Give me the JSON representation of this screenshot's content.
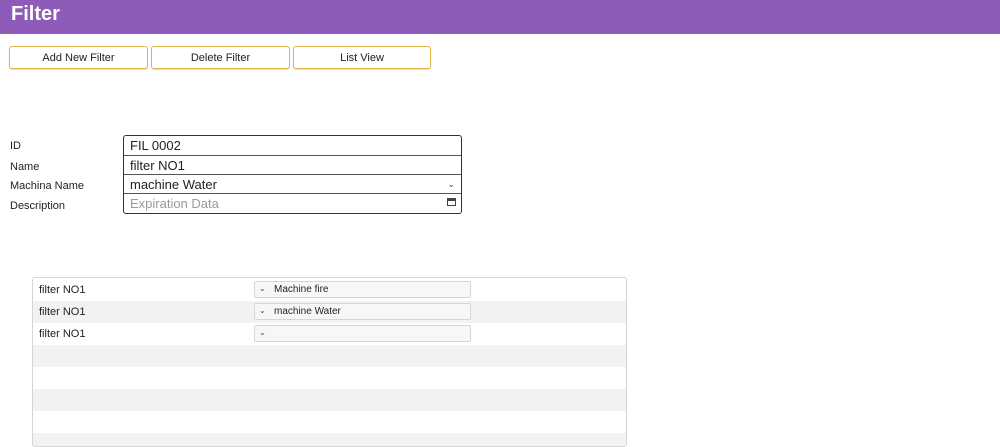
{
  "header": {
    "title": "Filter"
  },
  "toolbar": {
    "add_label": "Add New Filter",
    "delete_label": "Delete Filter",
    "list_label": "List View"
  },
  "form": {
    "id_label": "ID",
    "name_label": "Name",
    "machine_label": "Machina Name",
    "description_label": "Description",
    "id_value": "FIL 0002",
    "name_value": "filter NO1",
    "machine_value": "machine Water",
    "description_placeholder": "Expiration Data"
  },
  "grid": {
    "rows": [
      {
        "name": "filter NO1",
        "machine": "Machine fire"
      },
      {
        "name": "filter NO1",
        "machine": "machine Water"
      },
      {
        "name": "filter NO1",
        "machine": ""
      }
    ]
  },
  "icons": {
    "chevron": "chevron-down-icon",
    "calendar": "calendar-icon"
  },
  "colors": {
    "header": "#8e5cb8",
    "button_border": "#e0b54a"
  }
}
